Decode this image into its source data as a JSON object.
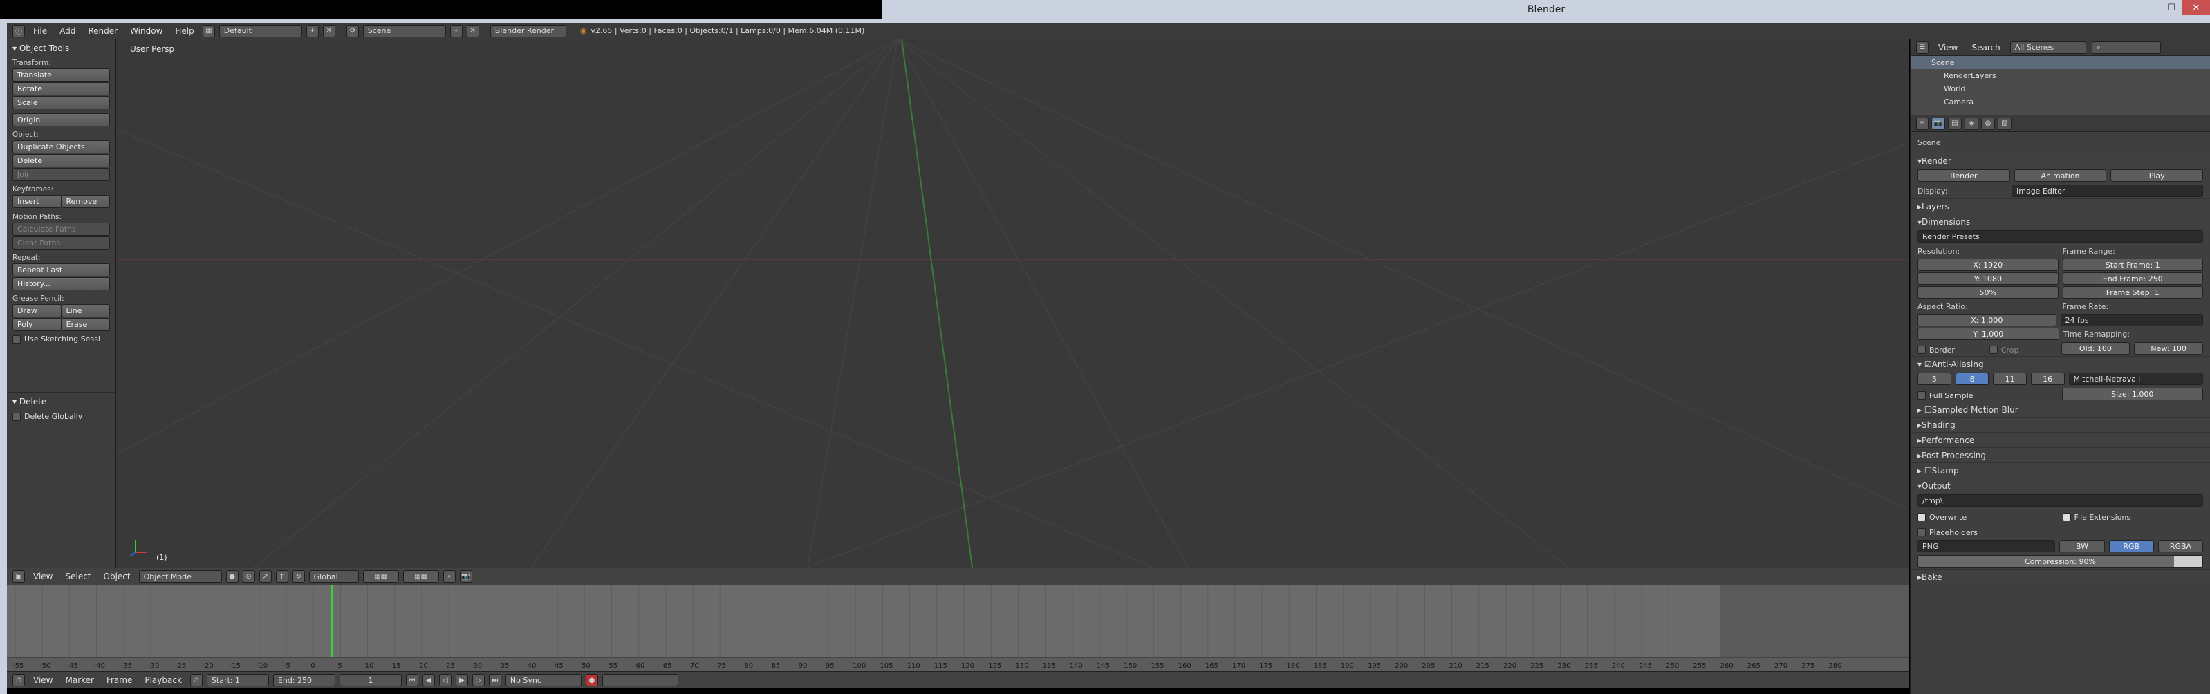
{
  "window": {
    "title": "Blender",
    "min": "—",
    "max": "☐",
    "close": "✕"
  },
  "info": {
    "menus": [
      "File",
      "Add",
      "Render",
      "Window",
      "Help"
    ],
    "screen": "Default",
    "scene": "Scene",
    "engine": "Blender Render",
    "stats": "v2.65 | Verts:0 | Faces:0 | Objects:0/1 | Lamps:0/0 | Mem:6.04M (0.11M)"
  },
  "shelf": {
    "title": "Object Tools",
    "transform_label": "Transform:",
    "translate": "Translate",
    "rotate": "Rotate",
    "scale": "Scale",
    "origin": "Origin",
    "object_label": "Object:",
    "duplicate": "Duplicate Objects",
    "delete": "Delete",
    "join": "Join",
    "keyframes_label": "Keyframes:",
    "insert": "Insert",
    "remove": "Remove",
    "motion_label": "Motion Paths:",
    "calc_paths": "Calculate Paths",
    "clear_paths": "Clear Paths",
    "repeat_label": "Repeat:",
    "repeat_last": "Repeat Last",
    "history": "History...",
    "grease_label": "Grease Pencil:",
    "draw": "Draw",
    "line": "Line",
    "poly": "Poly",
    "erase": "Erase",
    "sketch": "Use Sketching Sessi",
    "op_title": "Delete",
    "delete_globally": "Delete Globally"
  },
  "viewport": {
    "label": "User Persp",
    "frame_indicator": "(1)",
    "header": {
      "menus": [
        "View",
        "Select",
        "Object"
      ],
      "mode": "Object Mode",
      "orientation": "Global"
    }
  },
  "timeline": {
    "ticks": [
      "-55",
      "-50",
      "-45",
      "-40",
      "-35",
      "-30",
      "-25",
      "-20",
      "-15",
      "-10",
      "-5",
      "0",
      "5",
      "10",
      "15",
      "20",
      "25",
      "30",
      "35",
      "40",
      "45",
      "50",
      "55",
      "60",
      "65",
      "70",
      "75",
      "80",
      "85",
      "90",
      "95",
      "100",
      "105",
      "110",
      "115",
      "120",
      "125",
      "130",
      "135",
      "140",
      "145",
      "150",
      "155",
      "160",
      "165",
      "170",
      "175",
      "180",
      "185",
      "190",
      "195",
      "200",
      "205",
      "210",
      "215",
      "220",
      "225",
      "230",
      "235",
      "240",
      "245",
      "250",
      "255",
      "260",
      "265",
      "270",
      "275",
      "280"
    ],
    "menus": [
      "View",
      "Marker",
      "Frame",
      "Playback"
    ],
    "start": "Start: 1",
    "end": "End: 250",
    "current": "1",
    "sync": "No Sync"
  },
  "outliner": {
    "menus": [
      "View",
      "Search"
    ],
    "scope": "All Scenes",
    "rows": [
      "Scene",
      "RenderLayers",
      "World",
      "Camera"
    ]
  },
  "props": {
    "context": "Scene",
    "render": {
      "title": "Render",
      "render_btn": "Render",
      "anim_btn": "Animation",
      "play_btn": "Play",
      "display_label": "Display:",
      "display": "Image Editor"
    },
    "layers": "Layers",
    "dimensions": {
      "title": "Dimensions",
      "presets": "Render Presets",
      "resolution_label": "Resolution:",
      "res_x": "X: 1920",
      "res_y": "Y: 1080",
      "res_pct": "50%",
      "frame_range_label": "Frame Range:",
      "start": "Start Frame: 1",
      "end": "End Frame: 250",
      "step": "Frame Step: 1",
      "aspect_label": "Aspect Ratio:",
      "asp_x": "X: 1.000",
      "asp_y": "Y: 1.000",
      "frame_rate_label": "Frame Rate:",
      "fps": "24 fps",
      "remap_label": "Time Remapping:",
      "old": "Old: 100",
      "new": "New: 100",
      "border": "Border",
      "crop": "Crop"
    },
    "aa": {
      "title": "Anti-Aliasing",
      "samples": [
        "5",
        "8",
        "11",
        "16"
      ],
      "filter": "Mitchell-Netravali",
      "full_sample": "Full Sample",
      "size": "Size: 1.000"
    },
    "sections": [
      "Sampled Motion Blur",
      "Shading",
      "Performance",
      "Post Processing",
      "Stamp"
    ],
    "output": {
      "title": "Output",
      "path": "/tmp\\",
      "overwrite": "Overwrite",
      "file_ext": "File Extensions",
      "placeholders": "Placeholders",
      "format": "PNG",
      "bw": "BW",
      "rgb": "RGB",
      "rgba": "RGBA",
      "compression": "Compression: 90%"
    },
    "bake": "Bake"
  }
}
